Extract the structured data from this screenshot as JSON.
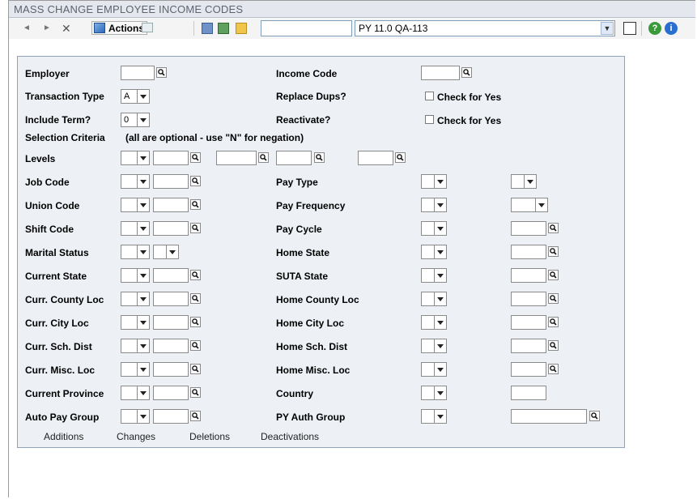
{
  "title": "MASS CHANGE EMPLOYEE INCOME CODES",
  "toolbar": {
    "actions_label": "Actions",
    "search_value": "",
    "environment_selected": "PY 11.0 QA-113",
    "icons": [
      "prev-arrow-icon",
      "next-arrow-icon",
      "close-icon",
      "actions-icon",
      "print-icon",
      "copy-icon",
      "mail-icon",
      "folder-icon",
      "dropdown-icon",
      "exit-icon",
      "help-icon",
      "info-icon"
    ]
  },
  "form": {
    "employer_label": "Employer",
    "employer_value": "",
    "income_code_label": "Income Code",
    "income_code_value": "",
    "transaction_type_label": "Transaction Type",
    "transaction_type_value": "A",
    "replace_dups_label": "Replace Dups?",
    "replace_dups_check_label": "Check for Yes",
    "include_term_label": "Include Term?",
    "include_term_value": "0",
    "reactivate_label": "Reactivate?",
    "reactivate_check_label": "Check for Yes",
    "selection_criteria_label": "Selection Criteria",
    "selection_criteria_note": "(all are optional - use \"N\" for negation)",
    "levels_label": "Levels",
    "left_rows": [
      "Job Code",
      "Union Code",
      "Shift Code",
      "Marital Status",
      "Current State",
      "Curr. County Loc",
      "Curr. City Loc",
      "Curr. Sch. Dist",
      "Curr. Misc. Loc",
      "Current Province",
      "Auto Pay Group"
    ],
    "right_rows": [
      "Pay Type",
      "Pay Frequency",
      "Pay Cycle",
      "Home State",
      "SUTA State",
      "Home County Loc",
      "Home City Loc",
      "Home Sch. Dist",
      "Home Misc. Loc",
      "Country",
      "PY Auth Group"
    ]
  },
  "bottom_links": [
    "Additions",
    "Changes",
    "Deletions",
    "Deactivations"
  ],
  "colors": {
    "panel_bg": "#edf1f6",
    "panel_border": "#8fa4b8",
    "title_text": "#5a6470",
    "title_bg": "#e4e8ee"
  }
}
